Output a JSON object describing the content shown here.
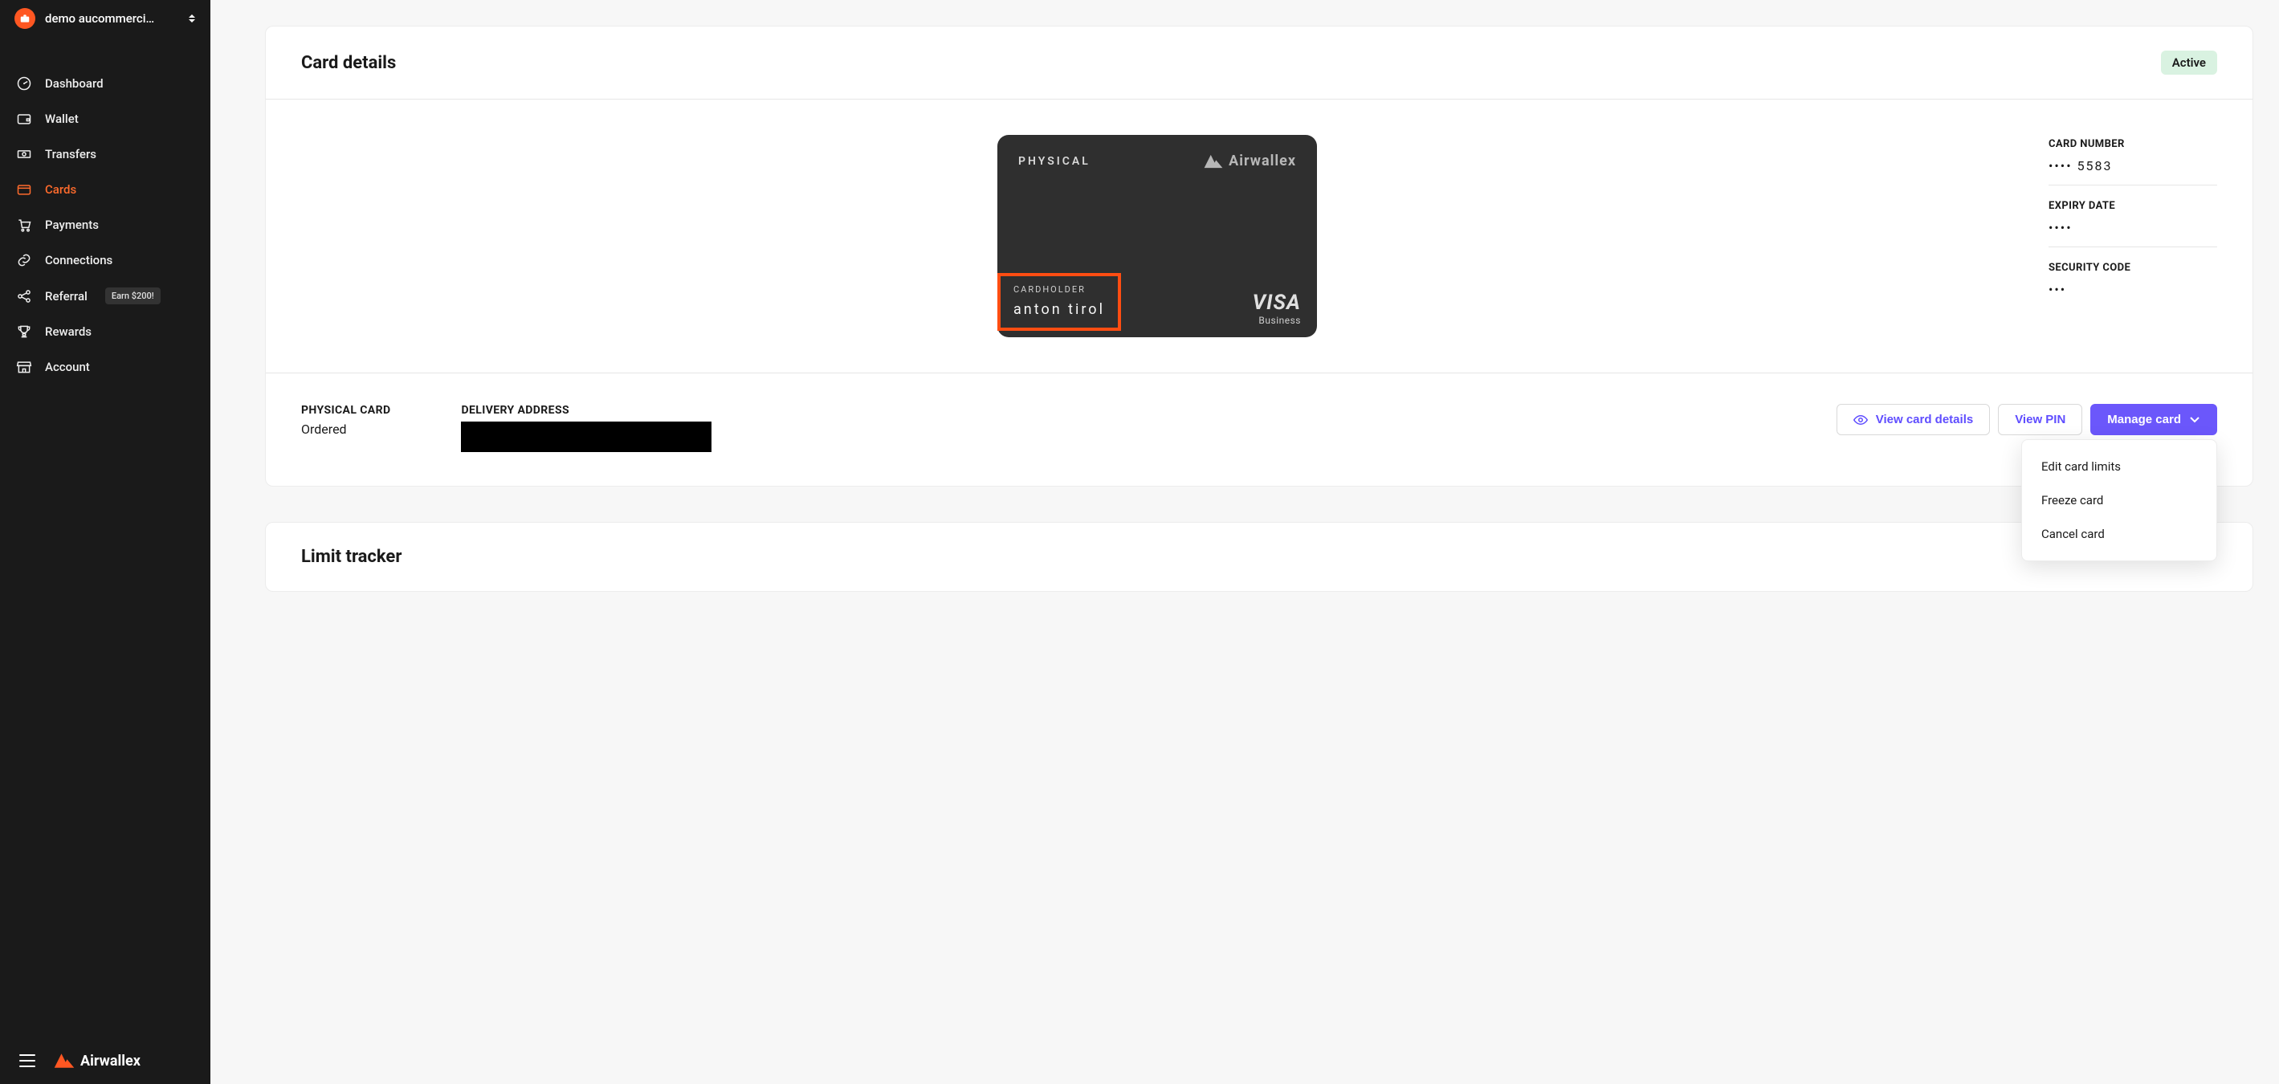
{
  "org": {
    "name": "demo aucommerci…"
  },
  "nav": {
    "dashboard": "Dashboard",
    "wallet": "Wallet",
    "transfers": "Transfers",
    "cards": "Cards",
    "payments": "Payments",
    "connections": "Connections",
    "referral": "Referral",
    "referral_badge": "Earn $200!",
    "rewards": "Rewards",
    "account": "Account"
  },
  "brand": {
    "name": "Airwallex"
  },
  "details": {
    "title": "Card details",
    "status": "Active",
    "card": {
      "type_label": "PHYSICAL",
      "brand": "Airwallex",
      "holder_label": "CARDHOLDER",
      "holder_name": "anton tirol",
      "network": "VISA",
      "network_sub": "Business"
    },
    "fields": {
      "number_label": "CARD NUMBER",
      "number_value": "••••  5583",
      "expiry_label": "EXPIRY DATE",
      "expiry_value": "••••",
      "cvv_label": "SECURITY CODE",
      "cvv_value": "•••"
    },
    "physical": {
      "label": "PHYSICAL CARD",
      "value": "Ordered"
    },
    "delivery": {
      "label": "DELIVERY ADDRESS"
    },
    "actions": {
      "view_details": "View card details",
      "view_pin": "View PIN",
      "manage": "Manage card",
      "menu": {
        "edit_limits": "Edit card limits",
        "freeze": "Freeze card",
        "cancel": "Cancel card"
      }
    }
  },
  "limits": {
    "title": "Limit tracker"
  }
}
